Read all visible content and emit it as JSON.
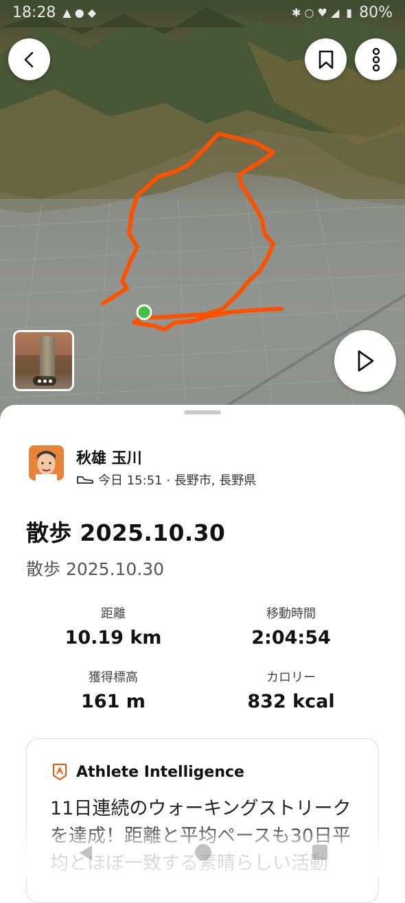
{
  "status_bar": {
    "time": "18:28",
    "battery": "80%"
  },
  "map": {
    "route_color": "#fc5200"
  },
  "user": {
    "name": "秋雄 玉川",
    "meta": "今日 15:51 · 長野市, 長野県"
  },
  "activity": {
    "title": "散歩 2025.10.30",
    "description": "散歩 2025.10.30"
  },
  "stats": {
    "distance": {
      "label": "距離",
      "value": "10.19 km"
    },
    "moving_time": {
      "label": "移動時間",
      "value": "2:04:54"
    },
    "elevation": {
      "label": "獲得標高",
      "value": "161 m"
    },
    "calories": {
      "label": "カロリー",
      "value": "832 kcal"
    }
  },
  "athlete_intelligence": {
    "title": "Athlete Intelligence",
    "text": "11日連続のウォーキングストリークを達成！距離と平均ペースも30日平均とほぼ一致する素晴らしい活動"
  },
  "icons": {
    "back": "chevron-left-icon",
    "bookmark": "bookmark-icon",
    "more": "more-vertical-icon",
    "play": "play-icon",
    "shoe": "shoe-icon",
    "athlete_intelligence": "athlete-intelligence-icon"
  }
}
